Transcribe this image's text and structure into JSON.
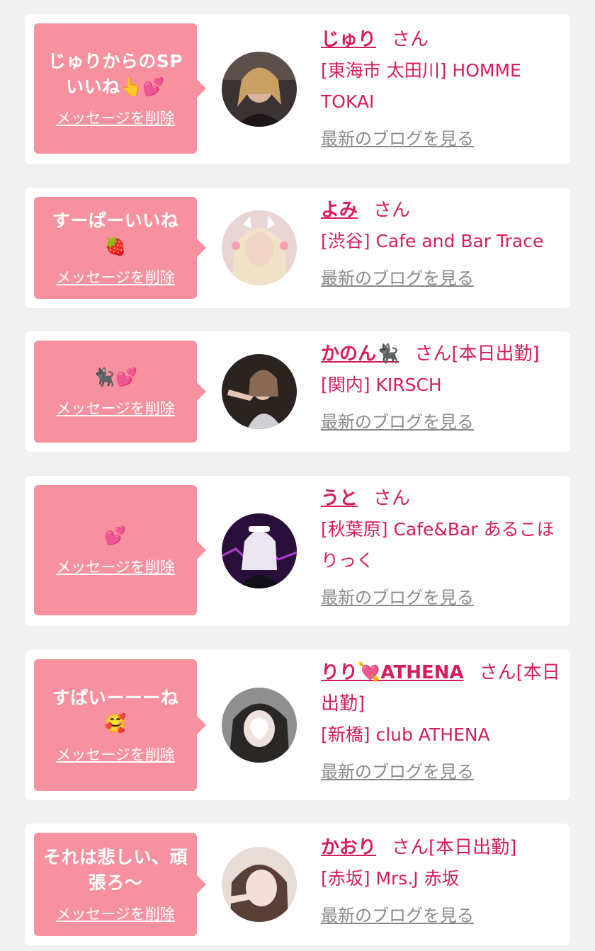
{
  "delete_label": "メッセージを削除",
  "blog_label": "最新のブログを見る",
  "colors": {
    "accent": "#d81b60",
    "bubble": "#f7919f",
    "link_gray": "#8a8a8a",
    "background": "#f1f1f1"
  },
  "items": [
    {
      "message": "じゅりからのSPいいね👆💕",
      "name": "じゅり",
      "suffix": "さん",
      "shop": "[東海市 太田川] HOMME TOKAI",
      "avatar_icon": "girl-photo"
    },
    {
      "message": "すーぱーいいね🍓",
      "name": "よみ",
      "suffix": "さん",
      "shop": "[渋谷] Cafe and Bar Trace",
      "avatar_icon": "girl-photo"
    },
    {
      "message": "🐈‍⬛💕",
      "name": "かのん🐈‍⬛",
      "suffix": "さん[本日出勤]",
      "shop": "[関内] KIRSCH",
      "avatar_icon": "girl-photo"
    },
    {
      "message": "💕",
      "name": "うと",
      "suffix": "さん",
      "shop": "[秋葉原] Cafe&Bar あるこほりっく",
      "avatar_icon": "girl-photo"
    },
    {
      "message": "すぱいーーーね🥰",
      "name": "りり💘ATHENA",
      "suffix": "さん[本日出勤]",
      "shop": "[新橋] club ATHENA",
      "avatar_icon": "girl-photo"
    },
    {
      "message": "それは悲しい、頑張ろ〜",
      "name": "かおり",
      "suffix": "さん[本日出勤]",
      "shop": "[赤坂] Mrs.J 赤坂",
      "avatar_icon": "girl-photo"
    }
  ]
}
